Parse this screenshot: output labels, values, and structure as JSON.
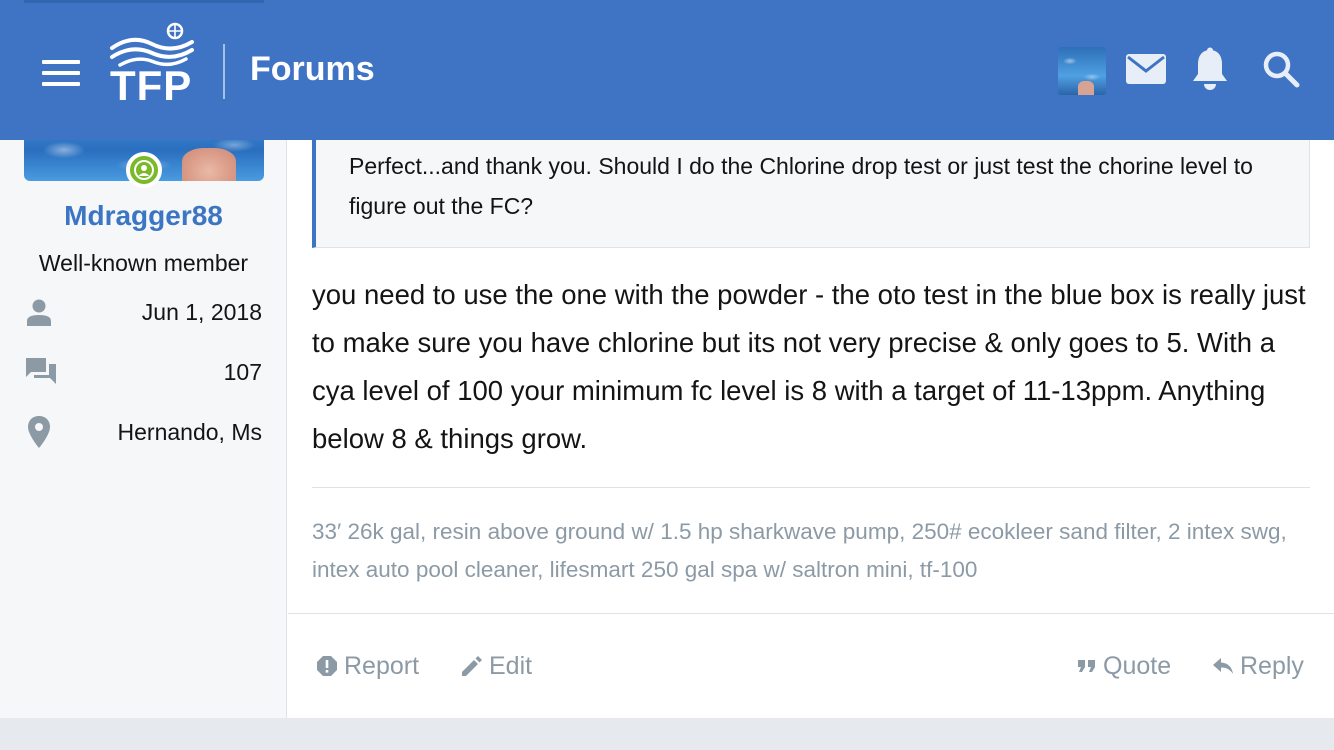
{
  "header": {
    "logo_text": "TFP",
    "section_title": "Forums"
  },
  "user": {
    "username": "Mdragger88",
    "title": "Well-known member",
    "stats": [
      {
        "icon": "person-icon",
        "value": "Jun 1, 2018"
      },
      {
        "icon": "messages-icon",
        "value": "107"
      },
      {
        "icon": "location-pin-icon",
        "value": "Hernando, Ms"
      }
    ]
  },
  "post": {
    "quote": "Perfect...and thank you. Should I do the Chlorine drop test or just test the chorine level to figure out the FC?",
    "body": "you need to use the one with the powder - the oto test in the blue box is really just to make sure you have chlorine but its not very precise & only goes to 5. With a cya level of 100 your minimum fc level is 8 with a target of 11-13ppm. Anything below 8 & things grow.",
    "signature": "33′ 26k gal, resin above ground w/ 1.5 hp sharkwave pump, 250# ecokleer sand filter, 2 intex swg, intex auto pool cleaner, lifesmart 250 gal spa w/ saltron mini, tf-100"
  },
  "actions": {
    "report": "Report",
    "edit": "Edit",
    "quote": "Quote",
    "reply": "Reply"
  },
  "colors": {
    "header": "#3f74c5",
    "link": "#3b75c3",
    "online": "#7ab929",
    "muted": "#8c9aa6"
  }
}
